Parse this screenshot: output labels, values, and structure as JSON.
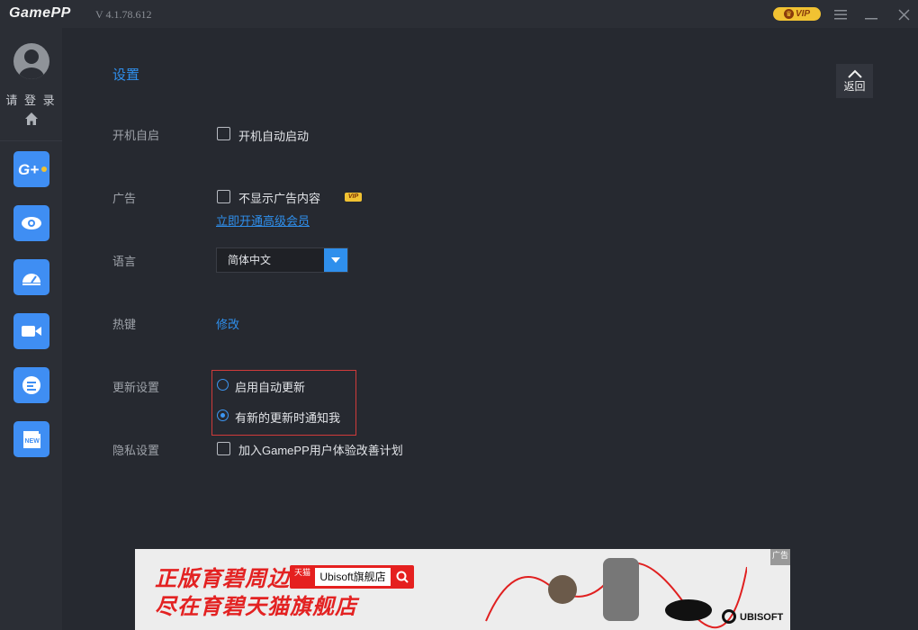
{
  "app": {
    "name": "GamePP",
    "version": "V 4.1.78.612",
    "vip_badge": "VIP"
  },
  "sidebar": {
    "login": "请 登 录",
    "items": [
      "G+",
      "eye",
      "dashboard",
      "video",
      "chat",
      "NEW"
    ]
  },
  "page": {
    "title": "设置",
    "back_label": "返回"
  },
  "settings": {
    "autostart": {
      "label": "开机自启",
      "option": "开机自动启动",
      "checked": false
    },
    "ads": {
      "label": "广告",
      "option": "不显示广告内容",
      "vip_tag": "VIP",
      "link": "立即开通高级会员",
      "checked": false
    },
    "language": {
      "label": "语言",
      "value": "简体中文"
    },
    "hotkey": {
      "label": "热键",
      "action": "修改"
    },
    "update": {
      "label": "更新设置",
      "options": [
        "启用自动更新",
        "有新的更新时通知我"
      ],
      "selected_index": 1
    },
    "privacy": {
      "label": "隐私设置",
      "option": "加入GamePP用户体验改善计划",
      "checked": false
    }
  },
  "banner": {
    "line1": "正版育碧周边",
    "line2": "尽在育碧天猫旗舰店",
    "tmall_logo": "天猫",
    "store": "Ubisoft旗舰店",
    "brand": "UBISOFT",
    "corner": "广告"
  },
  "colors": {
    "accent": "#2f8fec",
    "highlight_border": "#d03a3a",
    "nav_tile": "#3f8ef3"
  }
}
